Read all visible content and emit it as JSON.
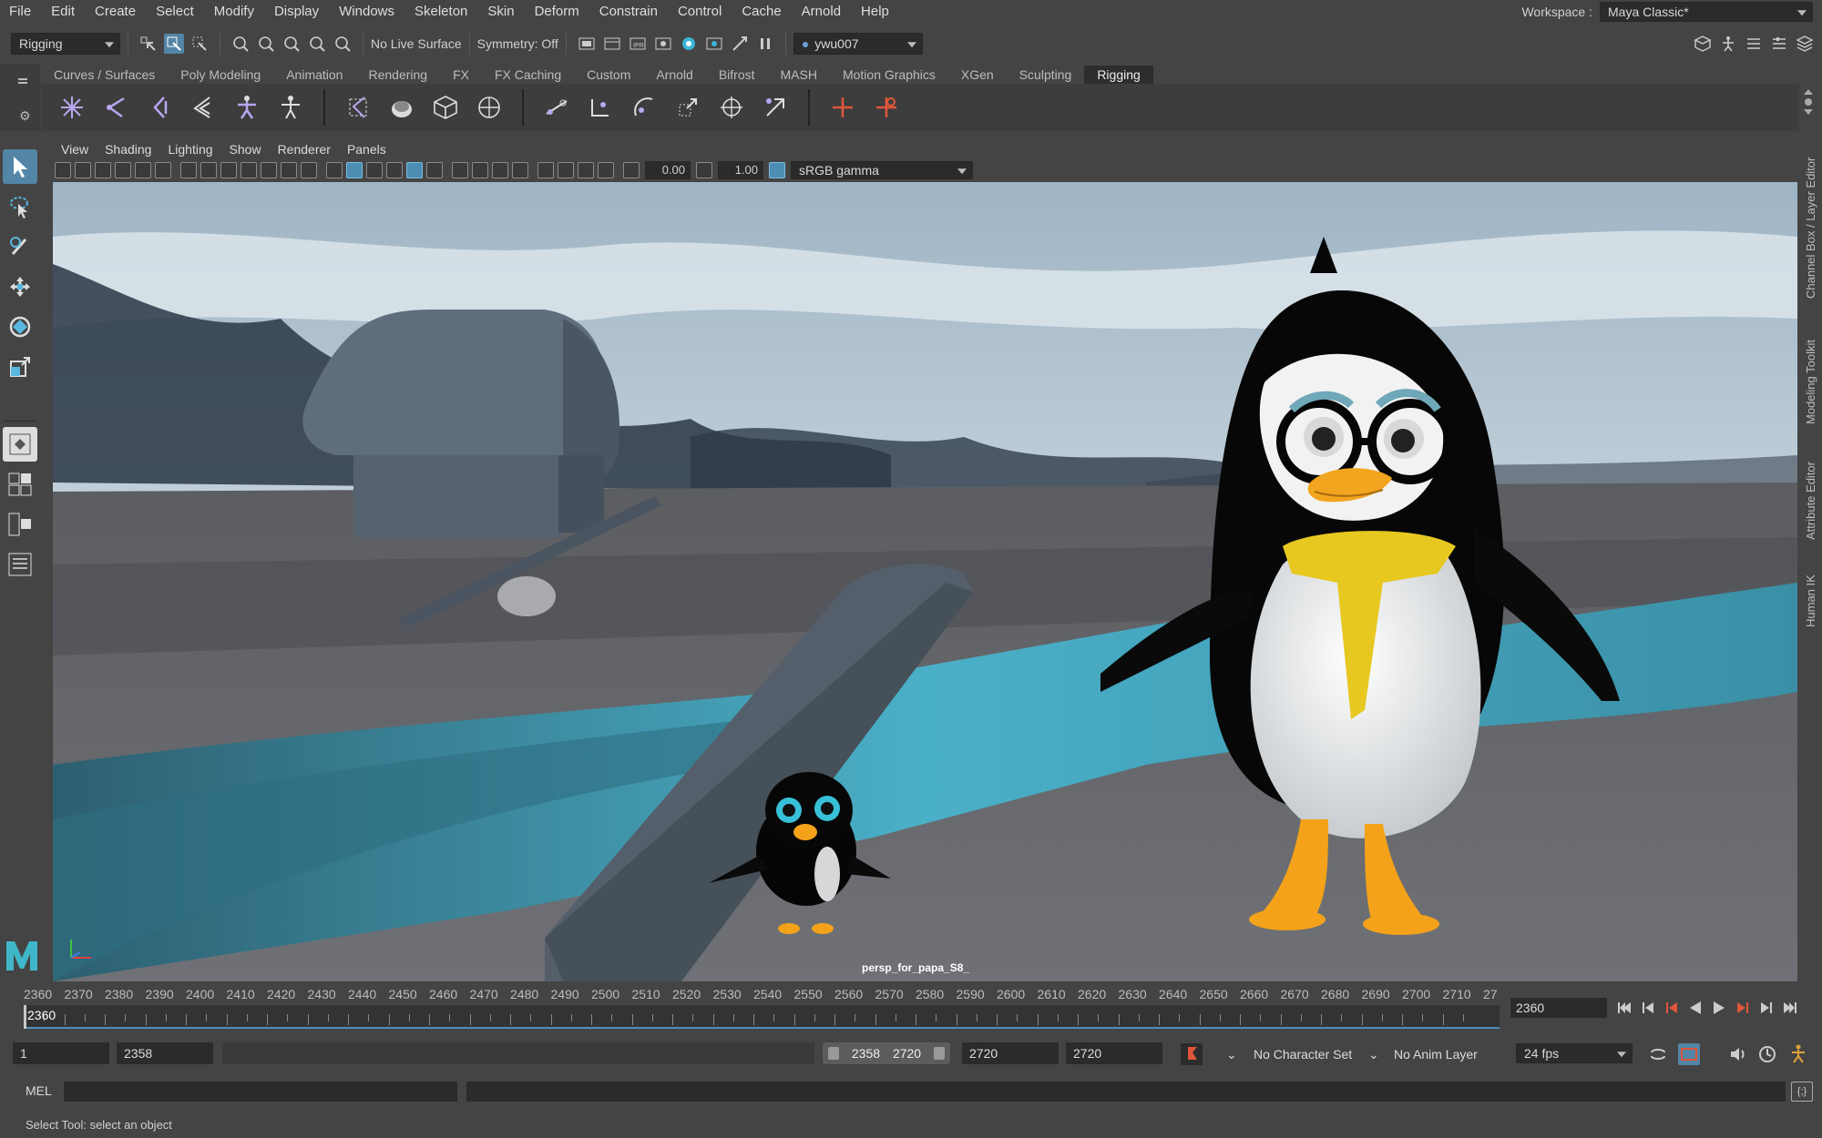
{
  "menubar": {
    "items": [
      "File",
      "Edit",
      "Create",
      "Select",
      "Modify",
      "Display",
      "Windows",
      "Skeleton",
      "Skin",
      "Deform",
      "Constrain",
      "Control",
      "Cache",
      "Arnold",
      "Help"
    ],
    "workspace_label": "Workspace :",
    "workspace_value": "Maya Classic*"
  },
  "statusline": {
    "menuset": "Rigging",
    "live_surface": "No Live Surface",
    "symmetry": "Symmetry: Off",
    "user": "ywu007"
  },
  "shelf": {
    "tabs": [
      "Curves / Surfaces",
      "Poly Modeling",
      "Animation",
      "Rendering",
      "FX",
      "FX Caching",
      "Custom",
      "Arnold",
      "Bifrost",
      "MASH",
      "Motion Graphics",
      "XGen",
      "Sculpting",
      "Rigging"
    ],
    "active_tab": "Rigging"
  },
  "viewport": {
    "menus": [
      "View",
      "Shading",
      "Lighting",
      "Show",
      "Renderer",
      "Panels"
    ],
    "exposure": "0.00",
    "gamma": "1.00",
    "color_space": "sRGB gamma",
    "camera_label": "persp_for_papa_S8_"
  },
  "side_tabs": [
    "Channel Box / Layer Editor",
    "Modeling Toolkit",
    "Attribute Editor",
    "Human IK"
  ],
  "timeline": {
    "ticks": [
      "2360",
      "2370",
      "2380",
      "2390",
      "2400",
      "2410",
      "2420",
      "2430",
      "2440",
      "2450",
      "2460",
      "2470",
      "2480",
      "2490",
      "2500",
      "2510",
      "2520",
      "2530",
      "2540",
      "2550",
      "2560",
      "2570",
      "2580",
      "2590",
      "2600",
      "2610",
      "2620",
      "2630",
      "2640",
      "2650",
      "2660",
      "2670",
      "2680",
      "2690",
      "2700",
      "2710",
      "27"
    ],
    "current_frame": "2360",
    "current_frame_field": "2360"
  },
  "range": {
    "start_time": "1",
    "playback_start": "2358",
    "slider_start": "2358",
    "slider_end": "2720",
    "playback_end": "2720",
    "end_time": "2720",
    "character_set": "No Character Set",
    "anim_layer": "No Anim Layer",
    "fps": "24 fps"
  },
  "cmdline": {
    "label": "MEL"
  },
  "helpline": {
    "text": "Select Tool: select an object"
  },
  "colors": {
    "accent": "#5285a6",
    "timeline_blue": "#4f8fc0",
    "key_red": "#e0563a"
  }
}
